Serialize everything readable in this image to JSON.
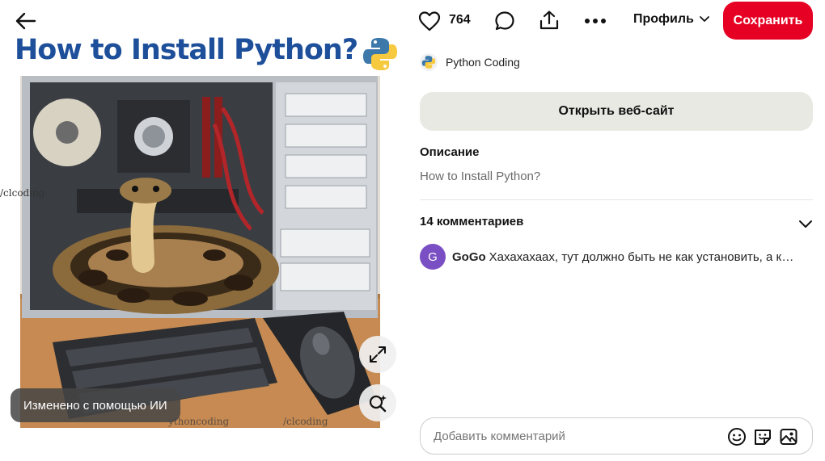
{
  "pin": {
    "title": "How to Install Python?",
    "side_watermark": "/clcoding",
    "bottom_watermarks": [
      "ythoncoding",
      "/clcoding"
    ],
    "ai_badge": "Изменено с помощью ИИ"
  },
  "toolbar": {
    "like_count": "764",
    "profile_label": "Профиль",
    "save_label": "Сохранить"
  },
  "author": {
    "name": "Python Coding"
  },
  "open_site_label": "Открыть веб-сайт",
  "description": {
    "heading": "Описание",
    "text": "How to Install Python?"
  },
  "comments": {
    "heading": "14 комментариев",
    "items": [
      {
        "avatar_letter": "G",
        "user": "GoGo",
        "text": "Хахахахаах, тут должно быть не как установить, а как удалить"
      }
    ],
    "input_placeholder": "Добавить комментарий"
  },
  "colors": {
    "accent": "#e60023",
    "title_blue": "#1d4f9a",
    "avatar_purple": "#7a4fc3",
    "button_gray": "#e9e9e4"
  },
  "icons": [
    "arrow-left-icon",
    "heart-icon",
    "comment-bubble-icon",
    "share-icon",
    "more-icon",
    "chevron-down-icon",
    "python-logo-icon",
    "expand-icon",
    "visual-search-icon",
    "emoji-icon",
    "sticker-icon",
    "image-icon"
  ]
}
